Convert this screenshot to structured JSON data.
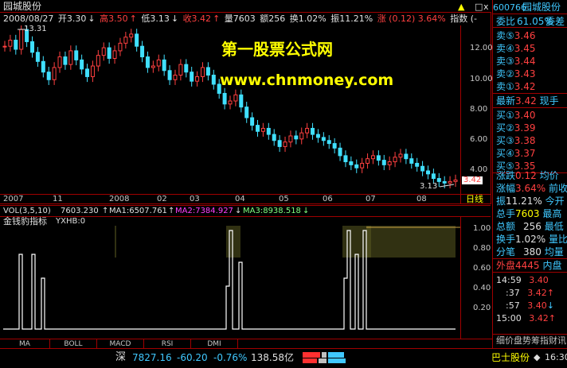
{
  "window": {
    "title": "园城股份"
  },
  "controls": {
    "up": "▲",
    "close": "x",
    "restore": "□"
  },
  "info_bar": {
    "date": "2008/08/27",
    "open": "开3.30",
    "high": "高3.50",
    "low": "低3.13",
    "close": "收3.42",
    "volume": "量7603",
    "amount": "额256",
    "turnover": "换1.02%",
    "amplitude": "振11.21%",
    "change": "涨 (0.12) 3.64%",
    "index_btn": "指数 (-"
  },
  "price_chart": {
    "high_label": "13.31",
    "low_label": "3.13",
    "current_price": "3.42",
    "y_ticks": [
      "12.00",
      "10.00",
      "8.00",
      "6.00",
      "4.00"
    ],
    "x_ticks": [
      "2007",
      "11",
      "2008",
      "02",
      "03",
      "04",
      "05",
      "06",
      "07",
      "08"
    ],
    "period_label": "日线"
  },
  "watermark": {
    "line1": "第一股票公式网",
    "line2": "www.chnmoney.com"
  },
  "vol_bar": {
    "label": "VOL(3,5,10)",
    "value": "7603.230",
    "ma1": "MA1:6507.761",
    "ma2": "MA2:7384.927",
    "ma3": "MA3:8938.518"
  },
  "indicator": {
    "title": "金钱豹指标",
    "formula": "YXHB:0",
    "y_ticks": [
      "1.00",
      "0.80",
      "0.60",
      "0.40",
      "0.20"
    ]
  },
  "tabs": [
    "MA",
    "BOLL",
    "MACD",
    "RSI",
    "DMI"
  ],
  "right_panel": {
    "code": "600766",
    "name": "园城股份",
    "weibi": "委比",
    "weibi_val": "61.05%",
    "weicha": "委差",
    "sell": [
      {
        "label": "卖⑤",
        "price": "3.46"
      },
      {
        "label": "卖④",
        "price": "3.45"
      },
      {
        "label": "卖③",
        "price": "3.44"
      },
      {
        "label": "卖②",
        "price": "3.43"
      },
      {
        "label": "卖①",
        "price": "3.42"
      }
    ],
    "latest_label": "最新",
    "latest_price": "3.42",
    "xianshou": "现手",
    "buy": [
      {
        "label": "买①",
        "price": "3.40"
      },
      {
        "label": "买②",
        "price": "3.39"
      },
      {
        "label": "买③",
        "price": "3.38"
      },
      {
        "label": "买④",
        "price": "3.37"
      },
      {
        "label": "买⑤",
        "price": "3.35"
      }
    ],
    "stats": [
      {
        "label": "涨跌",
        "value": "0.12",
        "label2": "均价"
      },
      {
        "label": "涨幅",
        "value": "3.64%",
        "label2": "前收"
      },
      {
        "label": "振",
        "value": "11.21%",
        "label2": "今开"
      },
      {
        "label": "总手",
        "value": "7603",
        "label2": "最高"
      },
      {
        "label": "总额",
        "value": "256",
        "label2": "最低"
      },
      {
        "label": "换手",
        "value": "1.02%",
        "label2": "量比"
      },
      {
        "label": "分笔",
        "value": "380",
        "label2": "均量"
      }
    ],
    "waipan": "外盘4445",
    "neipan": "内盘",
    "ticks": [
      {
        "time": "14:59",
        "price": "3.40",
        "arrow": ""
      },
      {
        "time": ":37",
        "price": "3.42",
        "arrow": "↑"
      },
      {
        "time": ":57",
        "price": "3.40",
        "arrow": "↓"
      },
      {
        "time": "15:00",
        "price": "3.42",
        "arrow": "↑"
      }
    ],
    "tabs_bottom": "细价盘势筹指财讯"
  },
  "status_bar": {
    "market": "深",
    "index": "7827.16",
    "change": "-60.20",
    "pct": "-0.76%",
    "amount": "138.58亿",
    "stock": "巴士股份",
    "time": "16:30"
  },
  "colors": {
    "up": "#ff4040",
    "down": "#40e0ff",
    "border": "#a00000",
    "accent": "#ffff00"
  }
}
